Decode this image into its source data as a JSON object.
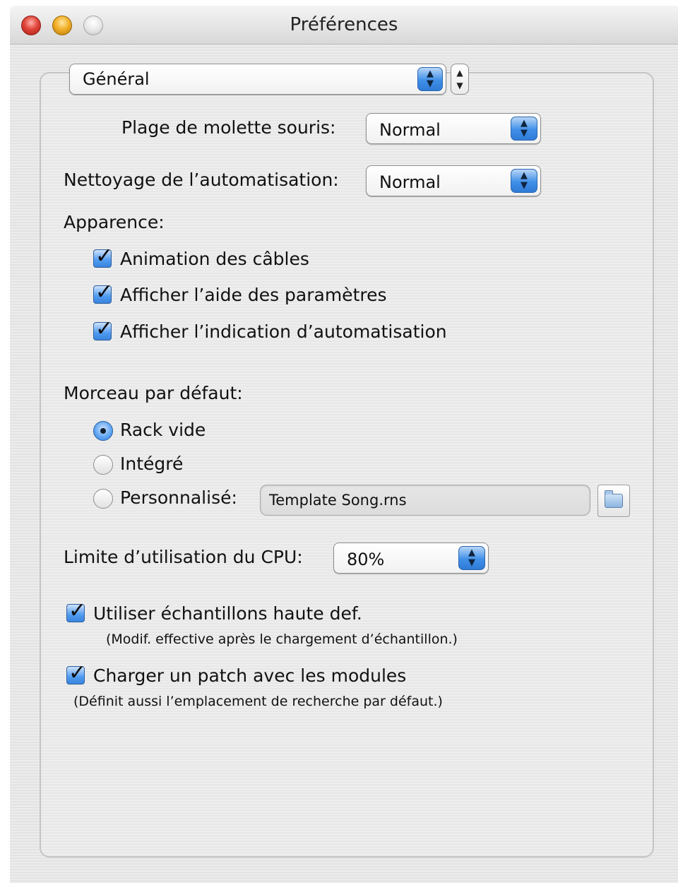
{
  "window": {
    "title": "Préférences"
  },
  "section_popup": {
    "value": "Général"
  },
  "mouse_wheel": {
    "label": "Plage de molette souris:",
    "value": "Normal"
  },
  "automation_cleanup": {
    "label": "Nettoyage de l’automatisation:",
    "value": "Normal"
  },
  "appearance": {
    "heading": "Apparence:",
    "options": [
      {
        "label": "Animation des câbles",
        "checked": true
      },
      {
        "label": "Afficher l’aide des paramètres",
        "checked": true
      },
      {
        "label": "Afficher l’indication d’automatisation",
        "checked": true
      }
    ]
  },
  "default_song": {
    "heading": "Morceau par défaut:",
    "options": [
      {
        "label": "Rack vide",
        "selected": true
      },
      {
        "label": "Intégré",
        "selected": false
      },
      {
        "label": "Personnalisé:",
        "selected": false
      }
    ],
    "custom_file": "Template Song.rns"
  },
  "cpu_limit": {
    "label": "Limite d’utilisation du CPU:",
    "value": "80%"
  },
  "high_res_samples": {
    "label": "Utiliser échantillons haute def.",
    "note": "(Modif. effective après le chargement d’échantillon.)",
    "checked": true
  },
  "load_patch": {
    "label": "Charger un patch avec les modules",
    "note": "(Définit aussi l’emplacement de recherche par défaut.)",
    "checked": true
  }
}
